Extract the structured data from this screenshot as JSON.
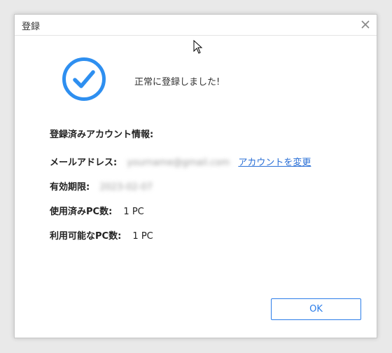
{
  "window": {
    "title": "登録"
  },
  "success": {
    "message": "正常に登録しました!"
  },
  "account": {
    "heading": "登録済みアカウント情報:",
    "email_label": "メールアドレス:",
    "email_value": "yourname@gmail.com",
    "change_link": "アカウントを変更",
    "expiry_label": "有効期限:",
    "expiry_value": "2023-02-07",
    "used_pc_label": "使用済みPC数:",
    "used_pc_value": "1 PC",
    "available_pc_label": "利用可能なPC数:",
    "available_pc_value": "1 PC"
  },
  "buttons": {
    "ok": "OK"
  },
  "colors": {
    "accent": "#2b7de9",
    "link": "#2a6fd6",
    "success_icon": "#2e8ff0"
  },
  "icons": {
    "close": "close-icon",
    "success": "check-circle-icon",
    "cursor": "mouse-cursor-icon"
  }
}
